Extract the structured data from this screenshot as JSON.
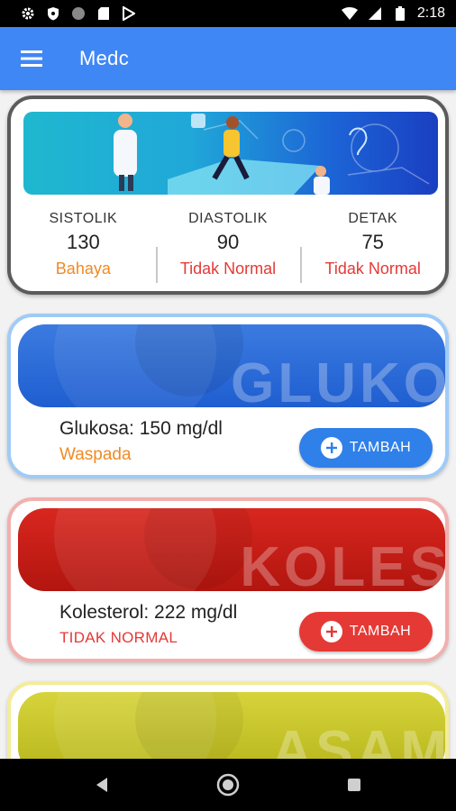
{
  "status_bar": {
    "time": "2:18"
  },
  "app_bar": {
    "title": "Medc"
  },
  "blood_pressure": {
    "items": [
      {
        "label": "SISTOLIK",
        "value": "130",
        "status": "Bahaya",
        "status_color": "#f08a24"
      },
      {
        "label": "DIASTOLIK",
        "value": "90",
        "status": "Tidak Normal",
        "status_color": "#e53935"
      },
      {
        "label": "DETAK",
        "value": "75",
        "status": "Tidak Normal",
        "status_color": "#e53935"
      }
    ]
  },
  "cards": [
    {
      "banner_text": "GLUKO",
      "name": "Glukosa: 150 mg/dl",
      "status": "Waspada",
      "status_color": "#f08a24",
      "button_label": "TAMBAH",
      "accent": "#2f80e8",
      "border": "#9fcbf7"
    },
    {
      "banner_text": "KOLES",
      "name": "Kolesterol: 222 mg/dl",
      "status": "TIDAK NORMAL",
      "status_color": "#e53935",
      "button_label": "TAMBAH",
      "accent": "#e53935",
      "border": "#f2b0ae"
    },
    {
      "banner_text": "ASAM",
      "accent": "#c8c62a",
      "border": "#f4ec98"
    }
  ]
}
